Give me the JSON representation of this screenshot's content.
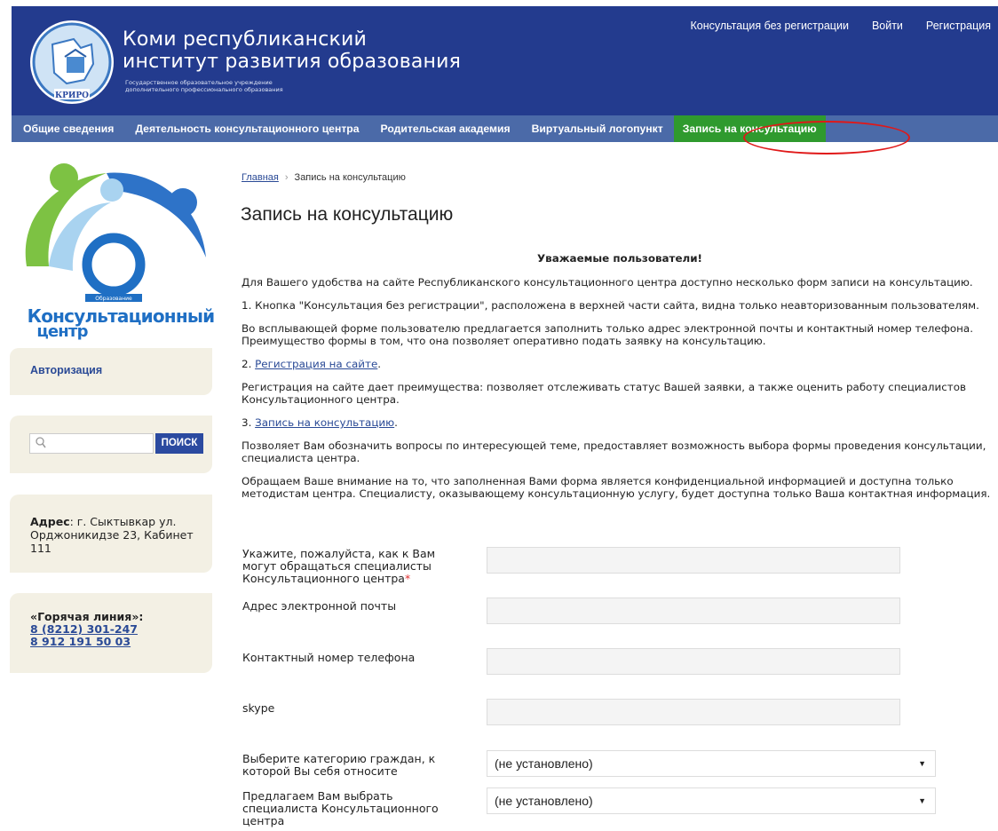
{
  "header": {
    "title_line1": "Коми республиканский",
    "title_line2": "институт развития образования",
    "subtitle_line1": "Государственное образовательное учреждение",
    "subtitle_line2": "дополнительного профессионального образования",
    "logo_text": "КРИРО",
    "top_links": [
      "Консультация без регистрации",
      "Войти",
      "Регистрация"
    ]
  },
  "nav": {
    "items": [
      "Общие сведения",
      "Деятельность консультационного центра",
      "Родительская академия",
      "Виртуальный логопункт",
      "Запись на консультацию"
    ],
    "active_index": 4
  },
  "sidebar": {
    "logo_small": "Образование",
    "logo_word1": "Консультационный",
    "logo_word2": "центр",
    "auth_label": "Авторизация",
    "search_placeholder": "",
    "search_button": "ПОИСК",
    "address_label": "Адрес",
    "address_text": ": г. Сыктывкар ул. Орджоникидзе 23, Кабинет 111",
    "hotline_label": "«Горячая линия»:",
    "hotline_phone1": "8 (8212) 301-247",
    "hotline_phone2": "8 912 191 50 03"
  },
  "breadcrumb": {
    "home": "Главная",
    "current": "Запись на консультацию"
  },
  "page_title": "Запись на консультацию",
  "content": {
    "greeting": "Уважаемые пользователи!",
    "p1": "Для Вашего удобства на сайте Республиканского консультационного центра доступно несколько форм записи на консультацию.",
    "p2": "1. Кнопка \"Консультация без регистрации\", расположена в верхней части сайта, видна только неавторизованным пользователям.",
    "p3": "Во всплывающей форме пользователю предлагается заполнить только адрес электронной почты и контактный номер телефона. Преимущество формы в том, что она позволяет оперативно подать заявку на консультацию.",
    "p4_prefix": "2. ",
    "p4_link": "Регистрация на сайте",
    "p4_suffix": ".",
    "p5": "Регистрация на сайте дает преимущества: позволяет отслеживать статус Вашей заявки, а также оценить работу специалистов Консультационного центра.",
    "p6_prefix": "3. ",
    "p6_link": "Запись на консультацию",
    "p6_suffix": ".",
    "p7": "Позволяет Вам обозначить вопросы по интересующей теме, предоставляет возможность выбора формы проведения консультации, специалиста центра.",
    "p8": "Обращаем Ваше внимание на то, что заполненная Вами форма является конфиденциальной информацией и доступна только методистам центра. Специалисту, оказывающему консультационную услугу, будет доступна только Ваша контактная информация."
  },
  "form": {
    "name_label": "Укажите, пожалуйста, как к Вам могут обращаться специалисты Консультационного центра",
    "required_mark": "*",
    "email_label": "Адрес электронной почты",
    "phone_label": "Контактный номер телефона",
    "skype_label": "skype",
    "category_label": "Выберите категорию граждан, к которой Вы себя относите",
    "category_value": "(не установлено)",
    "specialist_label": "Предлагаем Вам выбрать специалиста Консультационного центра",
    "specialist_value": "(не установлено)",
    "dropdown_arrow": "▼"
  }
}
